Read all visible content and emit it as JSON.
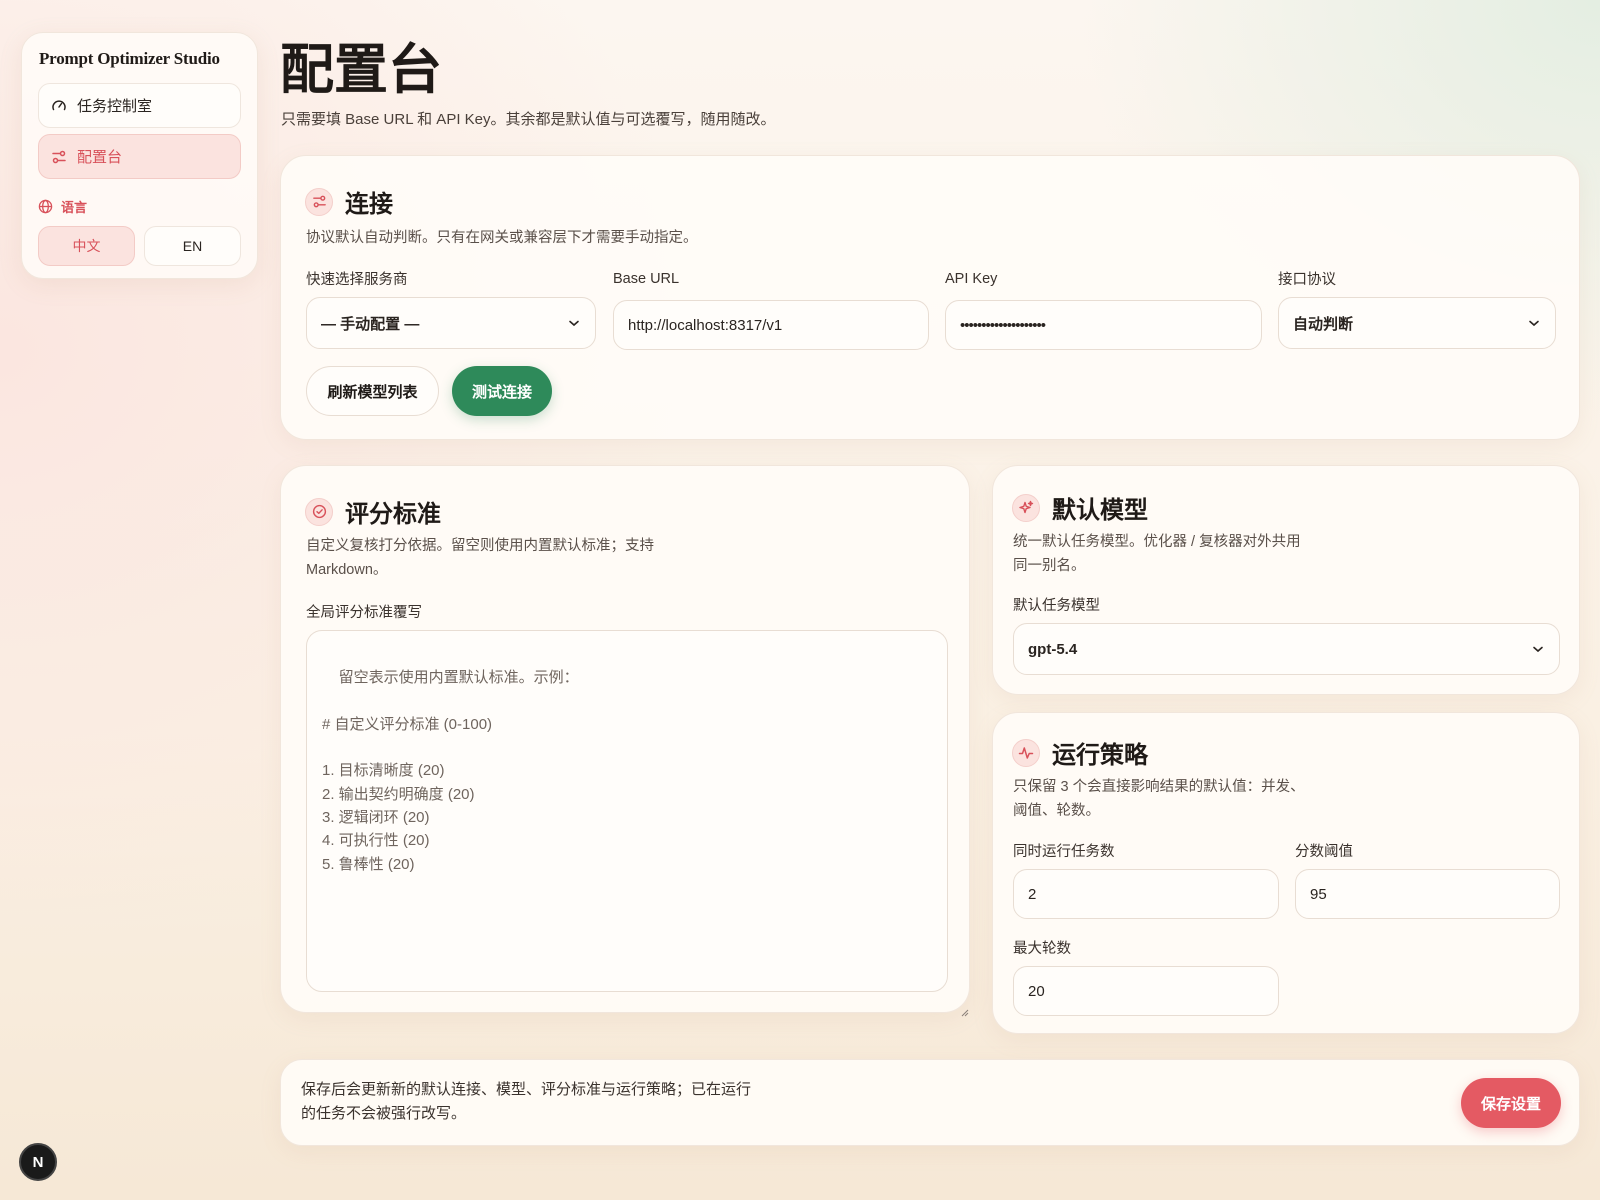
{
  "sidebar": {
    "brand": "Prompt Optimizer Studio",
    "items": [
      {
        "label": "任务控制室",
        "icon": "gauge-icon"
      },
      {
        "label": "配置台",
        "icon": "sliders-icon"
      }
    ],
    "language_label": "语言",
    "languages": [
      "中文",
      "EN"
    ],
    "active_language": "中文"
  },
  "header": {
    "title": "配置台",
    "subtitle": "只需要填 Base URL 和 API Key。其余都是默认值与可选覆写，随用随改。"
  },
  "connection": {
    "title": "连接",
    "description": "协议默认自动判断。只有在网关或兼容层下才需要手动指定。",
    "provider_label": "快速选择服务商",
    "provider_value": "— 手动配置 —",
    "base_url_label": "Base URL",
    "base_url_value": "http://localhost:8317/v1",
    "api_key_label": "API Key",
    "api_key_value": "••••••••••••••••••••",
    "protocol_label": "接口协议",
    "protocol_value": "自动判断",
    "refresh_button": "刷新模型列表",
    "test_button": "测试连接"
  },
  "rubric": {
    "title": "评分标准",
    "description_line1": "自定义复核打分依据。留空则使用内置默认标准；支持",
    "description_line2": "Markdown。",
    "field_label": "全局评分标准覆写",
    "placeholder": "留空表示使用内置默认标准。示例：\n\n# 自定义评分标准 (0-100)\n\n1. 目标清晰度 (20)\n2. 输出契约明确度 (20)\n3. 逻辑闭环 (20)\n4. 可执行性 (20)\n5. 鲁棒性 (20)"
  },
  "default_model": {
    "title": "默认模型",
    "description_line1": "统一默认任务模型。优化器 / 复核器对外共用",
    "description_line2": "同一别名。",
    "field_label": "默认任务模型",
    "value": "gpt-5.4"
  },
  "run_strategy": {
    "title": "运行策略",
    "description_line1": "只保留 3 个会直接影响结果的默认值：并发、",
    "description_line2": "阈值、轮数。",
    "concurrency_label": "同时运行任务数",
    "concurrency_value": "2",
    "threshold_label": "分数阈值",
    "threshold_value": "95",
    "max_rounds_label": "最大轮数",
    "max_rounds_value": "20"
  },
  "footer": {
    "note_line1": "保存后会更新新的默认连接、模型、评分标准与运行策略；已在运行",
    "note_line2": "的任务不会被强行改写。",
    "save_button": "保存设置"
  },
  "badge": {
    "label": "N"
  },
  "colors": {
    "accent": "#d8515a",
    "accent_bg": "#fbe3df",
    "green": "#2e8a5a",
    "save_red": "#e45a63",
    "text": "#1f1a17"
  }
}
